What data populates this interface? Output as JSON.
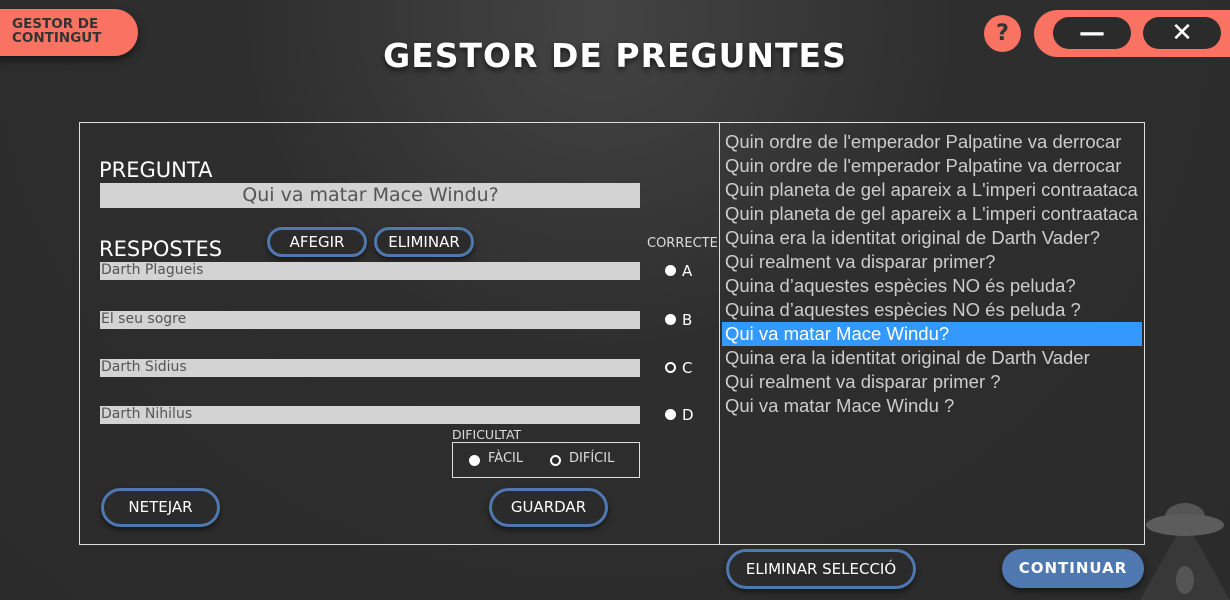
{
  "nav": {
    "content_manager": "GESTOR DE\nCONTINGUT"
  },
  "header": {
    "title": "GESTOR DE PREGUNTES",
    "help": "?",
    "minimize": "—",
    "close": "✕"
  },
  "form": {
    "question_label": "PREGUNTA",
    "question_value": "Qui va matar Mace Windu?",
    "answers_label": "RESPOSTES",
    "add_label": "AFEGIR",
    "delete_label": "ELIMINAR",
    "correct_label": "CORRECTE",
    "answers": [
      {
        "value": "Darth Plagueis",
        "letter": "A",
        "checked": false
      },
      {
        "value": "El seu sogre",
        "letter": "B",
        "checked": false
      },
      {
        "value": "Darth Sidius",
        "letter": "C",
        "checked": true
      },
      {
        "value": "Darth Nihilus",
        "letter": "D",
        "checked": false
      }
    ],
    "difficulty_label": "DIFICULTAT",
    "easy": "FÀCIL",
    "hard": "DIFÍCIL",
    "difficulty_selected": "DIFÍCIL",
    "clear_label": "NETEJAR",
    "save_label": "GUARDAR"
  },
  "questions": {
    "selected_index": 8,
    "items": [
      "Quin ordre de l'emperador Palpatine va derrocar",
      "Quin ordre de l'emperador Palpatine va derrocar",
      "Quin planeta de gel apareix a L'imperi contraataca",
      "Quin planeta de gel apareix a L'imperi contraataca",
      "Quina era la identitat original de Darth Vader?",
      "Qui realment va disparar primer?",
      "Quina d’aquestes espècies NO és peluda?",
      "Quina d’aquestes espècies NO és peluda ?",
      "Qui va matar Mace Windu?",
      " Quina era la identitat original de Darth Vader",
      "Qui realment va disparar primer ?",
      "Qui va matar Mace Windu ?"
    ]
  },
  "footer": {
    "delete_selection": "ELIMINAR SELECCIÓ",
    "continue": "CONTINUAR"
  },
  "colors": {
    "accent": "#f97262",
    "outline": "#4f78b0",
    "selection": "#3399ff",
    "continue": "#4f78b0"
  }
}
